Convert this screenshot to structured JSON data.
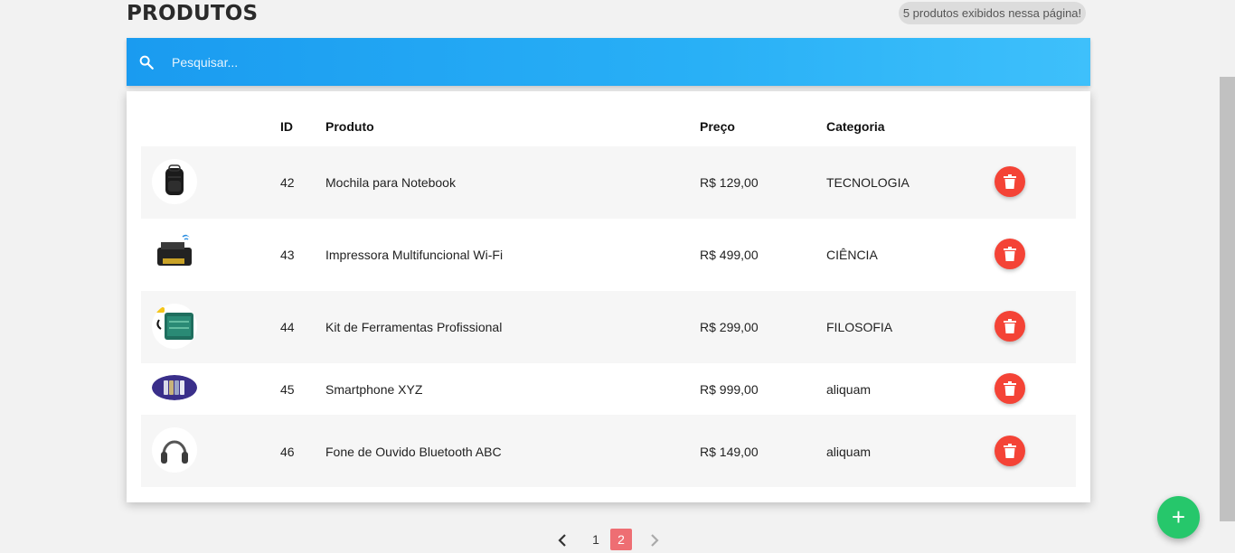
{
  "page": {
    "title": "PRODUTOS",
    "count_badge": "5 produtos exibidos nessa página!"
  },
  "search": {
    "placeholder": "Pesquisar...",
    "value": "",
    "icon": "search-icon"
  },
  "table": {
    "headers": {
      "id": "ID",
      "product": "Produto",
      "price": "Preço",
      "category": "Categoria"
    },
    "rows": [
      {
        "id": "42",
        "product": "Mochila para Notebook",
        "price": "R$ 129,00",
        "category": "TECNOLOGIA",
        "image": "backpack"
      },
      {
        "id": "43",
        "product": "Impressora Multifuncional Wi-Fi",
        "price": "R$ 499,00",
        "category": "CIÊNCIA",
        "image": "printer"
      },
      {
        "id": "44",
        "product": "Kit de Ferramentas Profissional",
        "price": "R$ 299,00",
        "category": "FILOSOFIA",
        "image": "toolkit"
      },
      {
        "id": "45",
        "product": "Smartphone XYZ",
        "price": "R$ 999,00",
        "category": "aliquam",
        "image": "smartphones"
      },
      {
        "id": "46",
        "product": "Fone de Ouvido Bluetooth ABC",
        "price": "R$ 149,00",
        "category": "aliquam",
        "image": "headphones"
      }
    ],
    "delete_icon": "trash-icon"
  },
  "pagination": {
    "pages": [
      "1",
      "2"
    ],
    "current": "2"
  },
  "fab": {
    "label": "+"
  },
  "colors": {
    "accent": "#1a9bf0",
    "delete": "#f44336",
    "active_page": "#ee6e73",
    "fab": "#26c76b"
  }
}
